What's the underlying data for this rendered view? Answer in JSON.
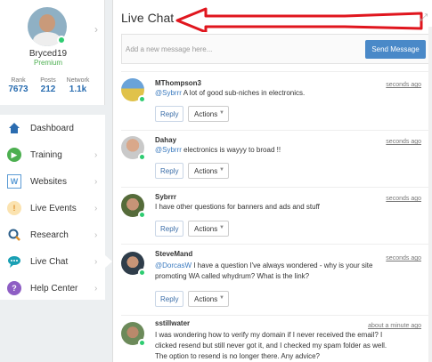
{
  "profile": {
    "username": "Bryced19",
    "level": "Premium",
    "stats": [
      {
        "label": "Rank",
        "value": "7673"
      },
      {
        "label": "Posts",
        "value": "212"
      },
      {
        "label": "Network",
        "value": "1.1k"
      }
    ]
  },
  "nav": {
    "items": [
      {
        "label": "Dashboard",
        "icon": "home-icon",
        "color": "#2b6cb0"
      },
      {
        "label": "Training",
        "icon": "play-icon",
        "color": "#4caf50"
      },
      {
        "label": "Websites",
        "icon": "websites-icon",
        "color": "#5b9bd5"
      },
      {
        "label": "Live Events",
        "icon": "live-events-icon",
        "color": "#f0a830"
      },
      {
        "label": "Research",
        "icon": "research-icon",
        "color": "#2c5f8a"
      },
      {
        "label": "Live Chat",
        "icon": "chat-icon",
        "color": "#1aa0b4"
      },
      {
        "label": "Help Center",
        "icon": "help-icon",
        "color": "#8e5ec4"
      }
    ]
  },
  "chat": {
    "title": "Live Chat",
    "composer_placeholder": "Add a new message here...",
    "send_label": "Send Message",
    "reply_label": "Reply",
    "actions_label": "Actions",
    "messages": [
      {
        "user": "MThompson3",
        "time": "seconds ago",
        "mention": "@Sybrrr",
        "text": " A lot of good sub-niches in electronics."
      },
      {
        "user": "Dahay",
        "time": "seconds ago",
        "mention": "@Sybrrr",
        "text": " electronics is wayyy to broad !!"
      },
      {
        "user": "Sybrrr",
        "time": "seconds ago",
        "mention": "",
        "text": "I have other questions for banners and ads and stuff"
      },
      {
        "user": "SteveMand",
        "time": "seconds ago",
        "mention": "@DorcasW",
        "text": " I have a question I've always wondered - why is your site promoting WA called whydrum? What is the link?"
      },
      {
        "user": "sstillwater",
        "time": "about a minute ago",
        "mention": "",
        "text": "I was wondering how to verify my domain if I never received the email? I clicked resend but still never got it, and I checked my spam folder as well. The option to resend is no longer there. Any advice?"
      }
    ]
  },
  "colors": {
    "accent": "#4a89c8",
    "online": "#2ecc71",
    "annotation_arrow": "#e0161e"
  }
}
